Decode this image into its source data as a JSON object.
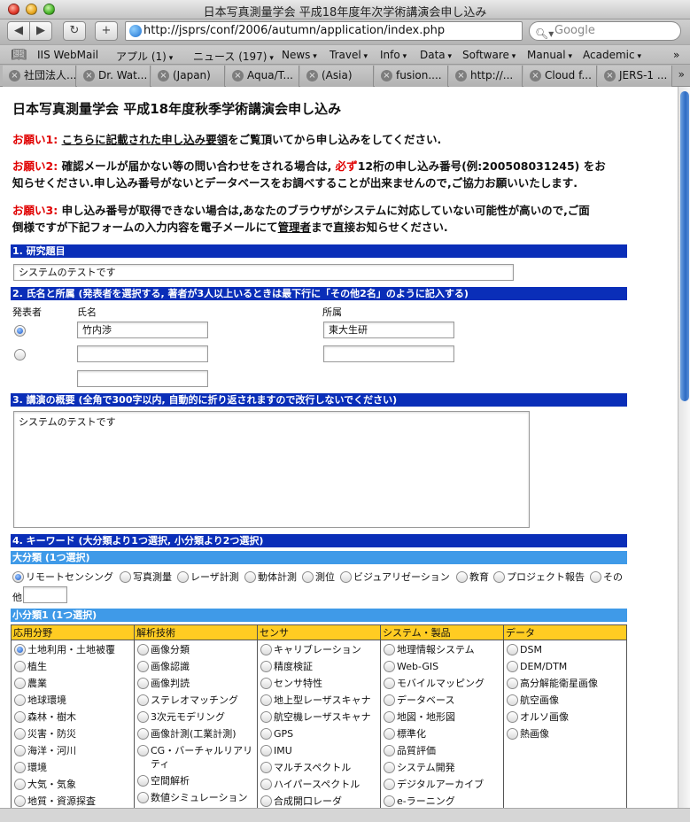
{
  "window": {
    "title": "日本写真測量学会 平成18年度年次学術講演会申し込み"
  },
  "toolbar": {
    "back": "◀",
    "forward": "▶",
    "reload": "↻",
    "add": "+",
    "url": "http://jsprs/conf/2006/autumn/application/index.php",
    "search_placeholder": "Google"
  },
  "bookmarks": [
    "IIS WebMail",
    "アプル (1)",
    "ニュース (197)",
    "News",
    "Travel",
    "Info",
    "Data",
    "Software",
    "Manual",
    "Academic"
  ],
  "tabs": [
    "社団法人...",
    "Dr. Wat...",
    "(Japan)",
    "Aqua/T...",
    "(Asia)",
    "fusion....",
    "http://...",
    "Cloud f...",
    "JERS-1 ..."
  ],
  "page": {
    "title": "日本写真測量学会 平成18年度秋季学術講演会申し込み",
    "notices": [
      {
        "label": "お願い1:",
        "text": "こちらに記載された申し込み要領",
        "text2": "をご覧頂いてから申し込みをしてください."
      },
      {
        "label": "お願い2:",
        "text": "確認メールが届かない等の問い合わせをされる場合は,",
        "must": "必ず",
        "text2": "12桁の申し込み番号(例:200508031245) をお",
        "text3": "知らせください.申し込み番号がないとデータベースをお調べすることが出来ませんので,ご協力お願いいたします."
      },
      {
        "label": "お願い3:",
        "text": "申し込み番号が取得できない場合は,あなたのブラウザがシステムに対応していない可能性が高いので,ご面",
        "text2": "倒様ですが下記フォームの入力内容を電子メールにて",
        "link": "管理者",
        "text3": "まで直接お知らせください."
      }
    ],
    "sec1": {
      "heading": "1. 研究題目",
      "value": "システムのテストです"
    },
    "sec2": {
      "heading": "2. 氏名と所属 (発表者を選択する, 著者が3人以上いるときは最下行に「その他2名」のように記入する)",
      "col_presenter": "発表者",
      "col_name": "氏名",
      "col_affil": "所属",
      "row1_name": "竹内渉",
      "row1_affil": "東大生研",
      "row2_name": "",
      "row2_affil": "",
      "row3_name": ""
    },
    "sec3": {
      "heading": "3. 講演の概要 (全角で300字以内, 自動的に折り返されますので改行しないでください)",
      "value": "システムのテストです"
    },
    "sec4": {
      "heading": "4. キーワード (大分類より1つ選択, 小分類より2つ選択)",
      "major_heading": "大分類 (1つ選択)",
      "major_options": [
        "リモートセンシング",
        "写真測量",
        "レーザ計測",
        "動体計測",
        "測位",
        "ビジュアリゼーション",
        "教育",
        "プロジェクト報告",
        "その"
      ],
      "major_other_label": "他",
      "major_selected": "リモートセンシング",
      "minor_heading": "小分類1 (1つ選択)",
      "columns": [
        {
          "title": "応用分野",
          "items": [
            "土地利用・土地被覆",
            "植生",
            "農業",
            "地球環境",
            "森林・樹木",
            "災害・防災",
            "海洋・河川",
            "環境",
            "大気・気象",
            "地質・資源探査"
          ]
        },
        {
          "title": "解析技術",
          "items": [
            "画像分類",
            "画像認識",
            "画像判読",
            "ステレオマッチング",
            "3次元モデリング",
            "画像計測(工業計測)",
            "CG・バーチャルリアリティ",
            "空間解析",
            "数値シミュレーション"
          ]
        },
        {
          "title": "センサ",
          "items": [
            "キャリブレーション",
            "精度検証",
            "センサ特性",
            "地上型レーザスキャナ",
            "航空機レーザスキャナ",
            "GPS",
            "IMU",
            "マルチスペクトル",
            "ハイパースペクトル",
            "合成開口レーダ"
          ]
        },
        {
          "title": "システム・製品",
          "items": [
            "地理情報システム",
            "Web-GIS",
            "モバイルマッピング",
            "データベース",
            "地図・地形図",
            "標準化",
            "品質評価",
            "システム開発",
            "デジタルアーカイブ",
            "e-ラーニング"
          ]
        },
        {
          "title": "データ",
          "items": [
            "DSM",
            "DEM/DTM",
            "高分解能衛星画像",
            "航空画像",
            "オルソ画像",
            "熱画像"
          ]
        }
      ],
      "minor_selected": "土地利用・土地被覆"
    }
  }
}
